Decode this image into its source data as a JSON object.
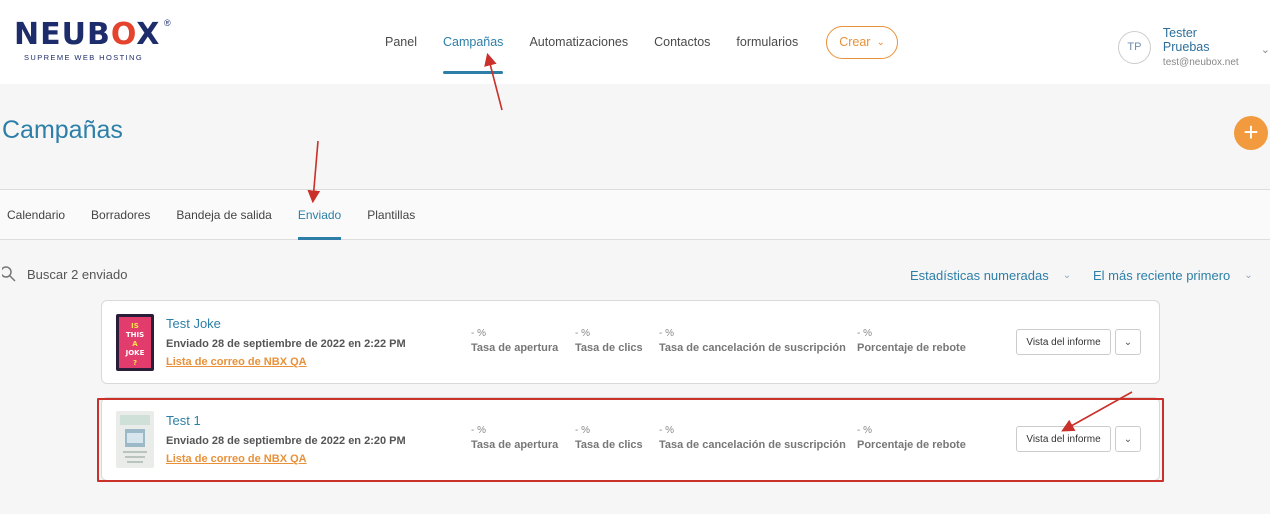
{
  "brand": {
    "name": "NEUBOX",
    "tagline": "SUPREME WEB HOSTING",
    "reg": "®"
  },
  "nav": {
    "items": [
      {
        "label": "Panel",
        "active": false
      },
      {
        "label": "Campañas",
        "active": true
      },
      {
        "label": "Automatizaciones",
        "active": false
      },
      {
        "label": "Contactos",
        "active": false
      },
      {
        "label": "formularios",
        "active": false
      }
    ],
    "create_label": "Crear"
  },
  "user": {
    "initials": "TP",
    "name": "Tester Pruebas",
    "email": "test@neubox.net"
  },
  "page": {
    "title": "Campañas",
    "add_icon": "plus-icon"
  },
  "subtabs": [
    {
      "label": "Calendario",
      "active": false
    },
    {
      "label": "Borradores",
      "active": false
    },
    {
      "label": "Bandeja de salida",
      "active": false
    },
    {
      "label": "Enviado",
      "active": true
    },
    {
      "label": "Plantillas",
      "active": false
    }
  ],
  "toolbar": {
    "search_label": "Buscar 2 enviado",
    "stats_filter": "Estadísticas numeradas",
    "sort_filter": "El más reciente primero"
  },
  "campaigns": [
    {
      "name": "Test Joke",
      "sent": "Enviado 28 de septiembre de 2022 en 2:22 PM",
      "list": "Lista de correo de NBX QA",
      "thumb_text": [
        "IS",
        "THIS",
        "A",
        "JOKE",
        "?"
      ],
      "stats": [
        {
          "value": "- %",
          "label": "Tasa de apertura"
        },
        {
          "value": "- %",
          "label": "Tasa de clics"
        },
        {
          "value": "- %",
          "label": "Tasa de cancelación de suscripción"
        },
        {
          "value": "- %",
          "label": "Porcentaje de rebote"
        }
      ],
      "report_label": "Vista del informe"
    },
    {
      "name": "Test 1",
      "sent": "Enviado 28 de septiembre de 2022 en 2:20 PM",
      "list": "Lista de correo de NBX QA",
      "thumb_text": [],
      "stats": [
        {
          "value": "- %",
          "label": "Tasa de apertura"
        },
        {
          "value": "- %",
          "label": "Tasa de clics"
        },
        {
          "value": "- %",
          "label": "Tasa de cancelación de suscripción"
        },
        {
          "value": "- %",
          "label": "Porcentaje de rebote"
        }
      ],
      "report_label": "Vista del informe"
    }
  ],
  "colors": {
    "accent": "#2d7fa8",
    "orange": "#e8913a",
    "highlight": "#c9312a"
  }
}
